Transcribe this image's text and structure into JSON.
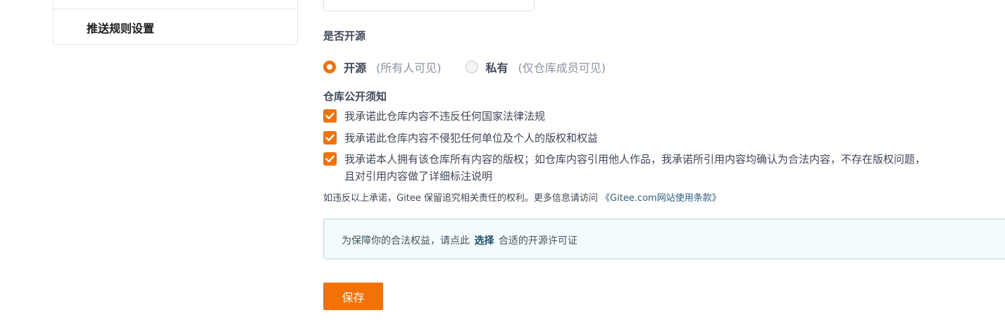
{
  "sidebar": {
    "items": [
      {
        "label": "推送规则设置"
      }
    ]
  },
  "form": {
    "top_input_value": "",
    "open_source_label": "是否开源",
    "visibility": {
      "options": [
        {
          "label": "开源",
          "hint": "(所有人可见)",
          "checked": true
        },
        {
          "label": "私有",
          "hint": "(仅仓库成员可见)",
          "checked": false
        }
      ]
    },
    "notice_label": "仓库公开须知",
    "pledges": [
      {
        "text": "我承诺此仓库内容不违反任何国家法律法规",
        "checked": true
      },
      {
        "text": "我承诺此仓库内容不侵犯任何单位及个人的版权和权益",
        "checked": true
      },
      {
        "text": "我承诺本人拥有该仓库所有内容的版权；如仓库内容引用他人作品，我承诺所引用内容均确认为合法内容，不存在版权问题，且对引用内容做了详细标注说明",
        "checked": true
      }
    ],
    "legal_note": {
      "text": "如违反以上承诺，Gitee 保留追究相关责任的权利。更多信息请访问 ",
      "link": "《Gitee.com网站使用条款》"
    },
    "license_box": {
      "prefix": "为保障你的合法权益，请点此",
      "link": "选择",
      "suffix": "合适的开源许可证"
    },
    "save_label": "保存"
  },
  "colors": {
    "accent": "#f37107",
    "text": "#40485b",
    "hint": "#8c92a4",
    "info_bg": "#f5fcfd",
    "info_border": "#c1dde5"
  },
  "icons": {
    "radio_checked": "radio-checked-icon",
    "radio_unchecked": "radio-unchecked-icon",
    "checkbox_checked": "checkmark-icon"
  }
}
